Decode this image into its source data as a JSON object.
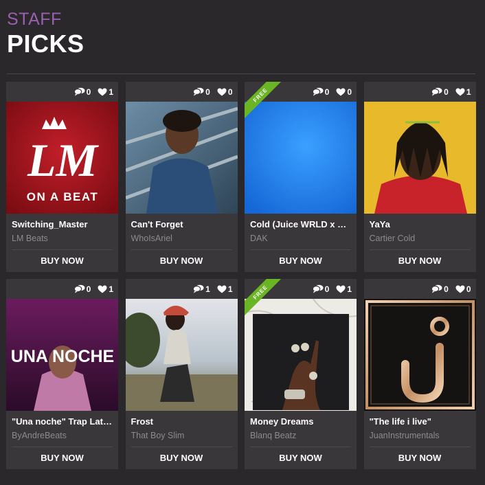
{
  "header": {
    "eyebrow": "STAFF",
    "title": "PICKS"
  },
  "cards": [
    {
      "name": "Switching_Master",
      "artist": "LM Beats",
      "comments": "0",
      "likes": "1",
      "buy_label": "BUY NOW",
      "art_text_main": "LM",
      "art_text_sub": "ON A BEAT"
    },
    {
      "name": "Can't Forget",
      "artist": "WhoIsAriel",
      "comments": "0",
      "likes": "0",
      "buy_label": "BUY NOW"
    },
    {
      "name": "Cold (Juice WRLD x Lil ...",
      "artist": "DAK",
      "comments": "0",
      "likes": "0",
      "buy_label": "BUY NOW",
      "ribbon": "FREE"
    },
    {
      "name": "YaYa",
      "artist": "Cartier Cold",
      "comments": "0",
      "likes": "1",
      "buy_label": "BUY NOW"
    },
    {
      "name": "\"Una noche\" Trap Lati...",
      "artist": "ByAndreBeats",
      "comments": "0",
      "likes": "1",
      "buy_label": "BUY NOW",
      "art_text_main": "UNA NOCHE"
    },
    {
      "name": "Frost",
      "artist": "That Boy Slim",
      "comments": "1",
      "likes": "1",
      "buy_label": "BUY NOW"
    },
    {
      "name": "Money Dreams",
      "artist": "Blanq Beatz",
      "comments": "0",
      "likes": "1",
      "buy_label": "BUY NOW",
      "ribbon": "FREE"
    },
    {
      "name": "\"The life i live\"",
      "artist": "JuanInstrumentals",
      "comments": "0",
      "likes": "0",
      "buy_label": "BUY NOW"
    }
  ],
  "colors": {
    "background": "#2b282b",
    "card": "#3a373a",
    "accent_purple": "#9b5fb0",
    "ribbon_green": "#6ab524",
    "muted_text": "#8d898d"
  },
  "icons": {
    "comment": "comment-icon",
    "like": "heart-icon"
  }
}
